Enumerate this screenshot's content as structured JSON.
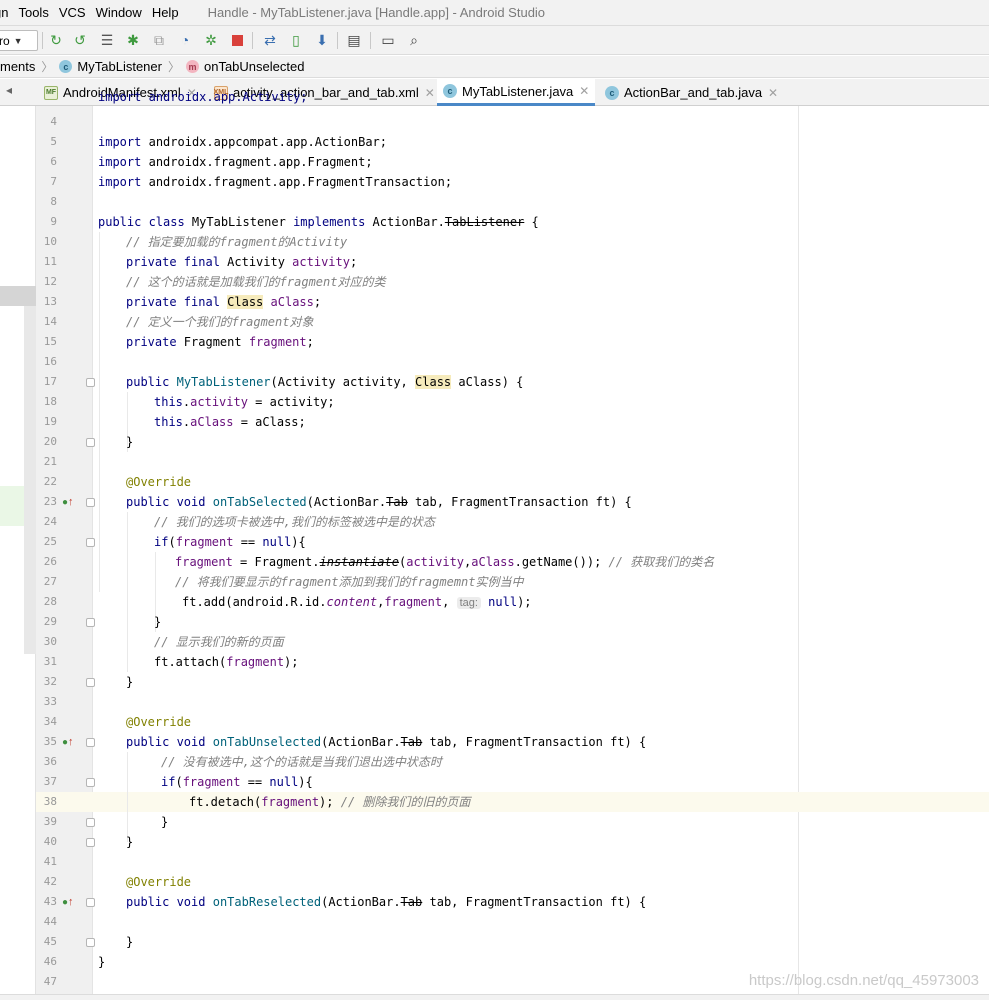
{
  "menubar": {
    "items": [
      "gn",
      "Tools",
      "VCS",
      "Window",
      "Help"
    ],
    "window_title": "Handle - MyTabListener.java [Handle.app] - Android Studio"
  },
  "toolbar": {
    "config_label": "ro",
    "icons": [
      "sync-icon",
      "sync-back-icon",
      "list-icon",
      "debug-bug-icon",
      "attach-debugger-icon",
      "profiler-gauge-icon",
      "apply-changes-icon",
      "stop-icon",
      "gradle-sync-icon",
      "avd-manager-icon",
      "sdk-manager-icon",
      "project-structure-icon",
      "layout-icon",
      "search-icon"
    ]
  },
  "breadcrumb": {
    "items": [
      {
        "label": "ments",
        "badge": ""
      },
      {
        "label": "MyTabListener",
        "badge": "c"
      },
      {
        "label": "onTabUnselected",
        "badge": "m"
      }
    ]
  },
  "tabs": [
    {
      "label": "AndroidManifest.xml",
      "icon": "MF",
      "active": false
    },
    {
      "label": "activity_action_bar_and_tab.xml",
      "icon": "XML",
      "active": false
    },
    {
      "label": "MyTabListener.java",
      "icon": "c",
      "active": true
    },
    {
      "label": "ActionBar_and_tab.java",
      "icon": "c",
      "active": false
    }
  ],
  "code": {
    "line_numbers": [
      "4",
      "5",
      "6",
      "7",
      "8",
      "9",
      "10",
      "11",
      "12",
      "13",
      "14",
      "15",
      "16",
      "17",
      "18",
      "19",
      "20",
      "21",
      "22",
      "23",
      "24",
      "25",
      "26",
      "27",
      "28",
      "29",
      "30",
      "31",
      "32",
      "33",
      "34",
      "35",
      "36",
      "37",
      "38",
      "39",
      "40",
      "41",
      "42",
      "43",
      "44",
      "45",
      "46",
      "47"
    ],
    "l3_partial": "import androidx.app.Activity;",
    "imports": [
      "androidx.appcompat.app.ActionBar",
      "androidx.fragment.app.Fragment",
      "androidx.fragment.app.FragmentTransaction"
    ],
    "comment_activity": "// 指定要加载的fragment的Activity",
    "comment_class": "// 这个的话就是加载我们的fragment对应的类",
    "comment_fragment": "// 定义一个我们的fragment对象",
    "comment_selected": "// 我们的选项卡被选中,我们的标签被选中是的状态",
    "comment_getname": "// 获取我们的类名",
    "comment_add": "// 将我们要显示的fragment添加到我们的fragmemnt实例当中",
    "comment_show": "// 显示我们的新的页面",
    "comment_unselected": "// 没有被选中,这个的话就是当我们退出选中状态时",
    "comment_remove": "// 删除我们的旧的页面",
    "param_hint": "tag:",
    "annotation": "@Override"
  },
  "watermark": "https://blog.csdn.net/qq_45973003"
}
